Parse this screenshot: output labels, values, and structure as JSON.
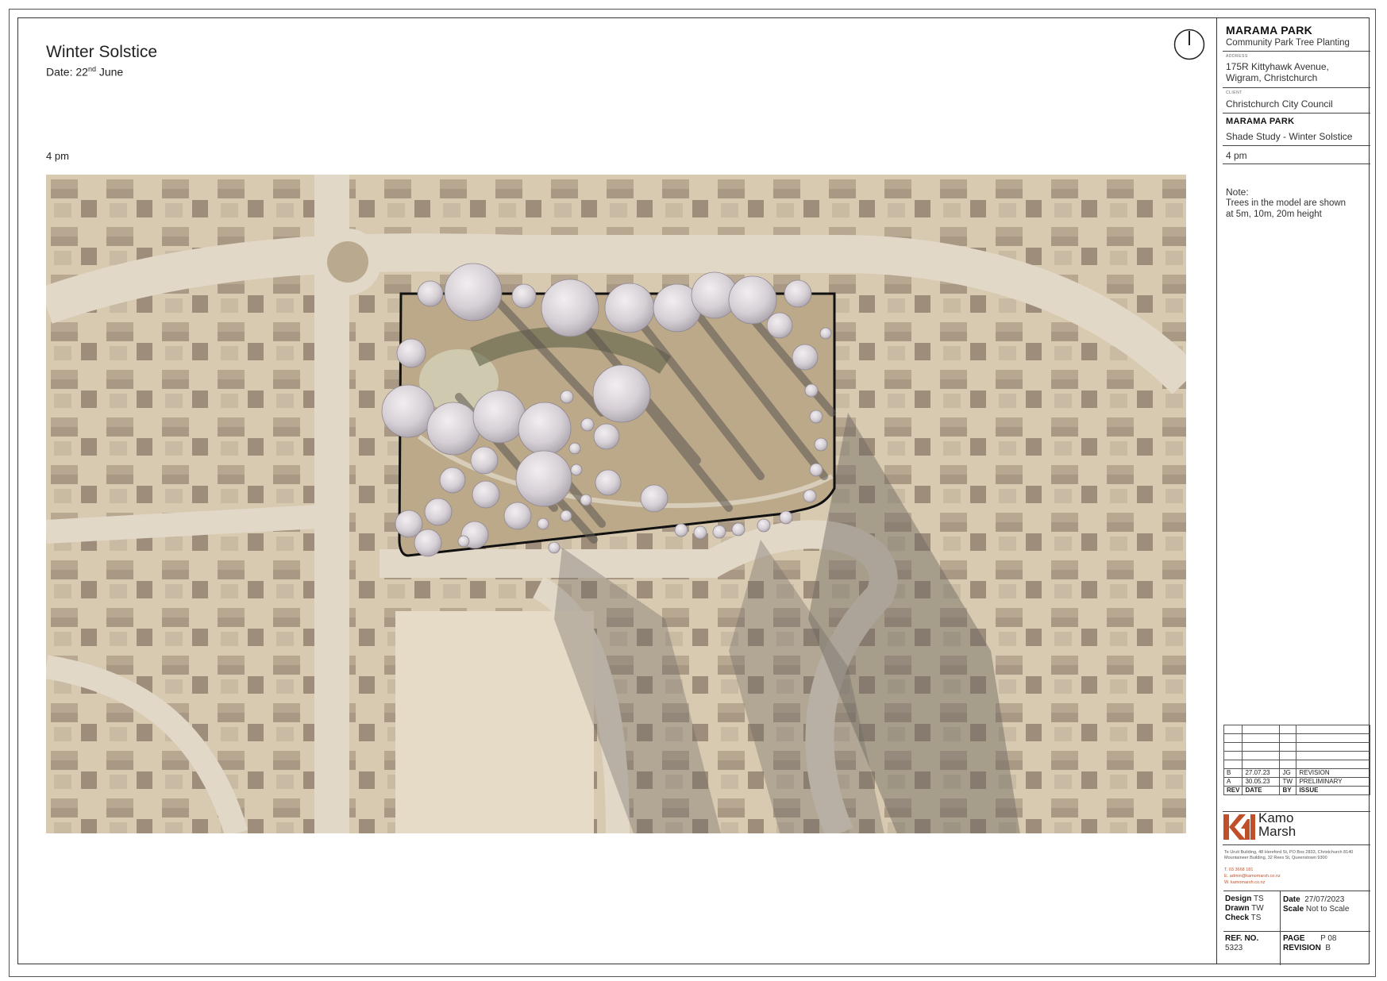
{
  "sheet": {
    "title": "Winter Solstice",
    "date_prefix": "Date: 22",
    "date_sup": "nd",
    "date_suffix": " June",
    "time_label": "4 pm"
  },
  "title_block": {
    "project": "MARAMA PARK",
    "subtitle": "Community Park Tree Planting",
    "address_caption": "ADDRESS",
    "address_line1": "175R Kittyhawk Avenue,",
    "address_line2": "Wigram, Christchurch",
    "client_caption": "CLIENT",
    "client": "Christchurch City Council",
    "drawing_project": "MARAMA PARK",
    "drawing_title": "Shade Study - Winter Solstice",
    "drawing_time": "4 pm",
    "note_title": "Note:",
    "note_line1": "Trees in the model are shown",
    "note_line2": "at 5m, 10m, 20m height"
  },
  "revisions": {
    "rows": [
      {
        "rev": "B",
        "date": "27.07.23",
        "by": "JG",
        "issue": "REVISION"
      },
      {
        "rev": "A",
        "date": "30.05.23",
        "by": "TW",
        "issue": "PRELIMINARY"
      }
    ],
    "header": {
      "rev": "REV",
      "date": "DATE",
      "by": "BY",
      "issue": "ISSUE"
    }
  },
  "company": {
    "name_line1": "Kamo",
    "name_line2": "Marsh",
    "address1": "Te Uruti Building, 48 Hereford St, PO Box 2833, Christchurch 8140",
    "address2": "Mountaineer Building, 32 Rees St, Queenstown 9300",
    "phone": "T.  03 3668 181",
    "email": "E.  admin@kamomarsh.co.nz",
    "web": "W.  kamomarsh.co.nz",
    "brand_color": "#c0502a"
  },
  "info": {
    "design_label": "Design",
    "design": "TS",
    "drawn_label": "Drawn",
    "drawn": "TW",
    "check_label": "Check",
    "check": "TS",
    "date_label": "Date",
    "date": "27/07/2023",
    "scale_label": "Scale",
    "scale": "Not to Scale",
    "ref_label": "REF. NO.",
    "ref": "5323",
    "page_label": "PAGE",
    "page": "P 08",
    "revision_label": "REVISION",
    "revision": "B"
  },
  "icons": {
    "north": "north-arrow-icon",
    "logo": "kamo-marsh-logo-icon"
  }
}
